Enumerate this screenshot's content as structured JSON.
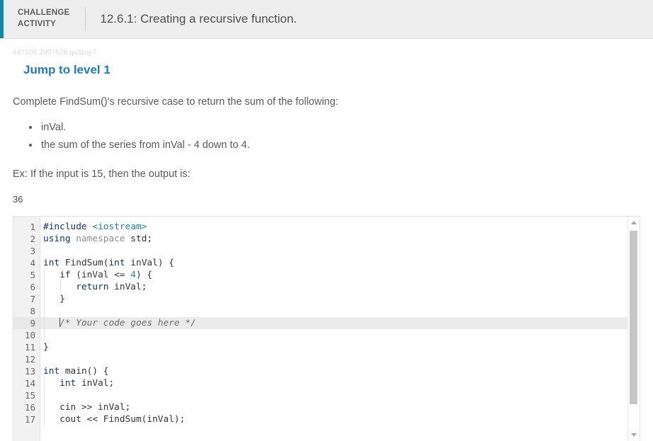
{
  "header": {
    "kicker": "CHALLENGE\nACTIVITY",
    "title": "12.6.1: Creating a recursive function.",
    "accent_color": "#1a84ab"
  },
  "activity": {
    "id": "447108.2097828.qx3zqy7",
    "level_heading": "Jump to level 1",
    "prompt": "Complete FindSum()'s recursive case to return the sum of the following:",
    "bullets": [
      "inVal.",
      "the sum of the series from inVal - 4 down to 4."
    ],
    "example_label": "Ex: If the input is 15, then the output is:",
    "example_output": "36"
  },
  "editor": {
    "active_line": 9,
    "line_numbers": [
      1,
      2,
      3,
      4,
      5,
      6,
      7,
      8,
      9,
      10,
      11,
      12,
      13,
      14,
      15,
      16,
      17
    ],
    "lines": [
      {
        "n": 1,
        "tokens": [
          {
            "t": "pre",
            "v": "#include"
          },
          {
            "t": "plain",
            "v": " "
          },
          {
            "t": "str",
            "v": "<iostream>"
          }
        ]
      },
      {
        "n": 2,
        "tokens": [
          {
            "t": "key",
            "v": "using"
          },
          {
            "t": "plain",
            "v": " "
          },
          {
            "t": "dim",
            "v": "namespace"
          },
          {
            "t": "plain",
            "v": " std;"
          }
        ]
      },
      {
        "n": 3,
        "tokens": []
      },
      {
        "n": 4,
        "tokens": [
          {
            "t": "key",
            "v": "int"
          },
          {
            "t": "plain",
            "v": " FindSum("
          },
          {
            "t": "key",
            "v": "int"
          },
          {
            "t": "plain",
            "v": " inVal) {"
          }
        ]
      },
      {
        "n": 5,
        "tokens": [
          {
            "t": "plain",
            "v": "   "
          },
          {
            "t": "key",
            "v": "if"
          },
          {
            "t": "plain",
            "v": " (inVal <= "
          },
          {
            "t": "num",
            "v": "4"
          },
          {
            "t": "plain",
            "v": ") {"
          }
        ]
      },
      {
        "n": 6,
        "tokens": [
          {
            "t": "plain",
            "v": "      "
          },
          {
            "t": "key",
            "v": "return"
          },
          {
            "t": "plain",
            "v": " inVal;"
          }
        ]
      },
      {
        "n": 7,
        "tokens": [
          {
            "t": "plain",
            "v": "   }"
          }
        ]
      },
      {
        "n": 8,
        "tokens": []
      },
      {
        "n": 9,
        "tokens": [
          {
            "t": "plain",
            "v": "   "
          },
          {
            "t": "caret",
            "v": ""
          },
          {
            "t": "com",
            "v": "/* Your code goes here */"
          }
        ]
      },
      {
        "n": 10,
        "tokens": []
      },
      {
        "n": 11,
        "tokens": [
          {
            "t": "plain",
            "v": "}"
          }
        ]
      },
      {
        "n": 12,
        "tokens": []
      },
      {
        "n": 13,
        "tokens": [
          {
            "t": "key",
            "v": "int"
          },
          {
            "t": "plain",
            "v": " main() {"
          }
        ]
      },
      {
        "n": 14,
        "tokens": [
          {
            "t": "plain",
            "v": "   "
          },
          {
            "t": "key",
            "v": "int"
          },
          {
            "t": "plain",
            "v": " inVal;"
          }
        ]
      },
      {
        "n": 15,
        "tokens": []
      },
      {
        "n": 16,
        "tokens": [
          {
            "t": "plain",
            "v": "   cin >> inVal;"
          }
        ]
      },
      {
        "n": 17,
        "tokens": [
          {
            "t": "plain",
            "v": "   cout << FindSum(inVal);"
          }
        ]
      }
    ],
    "scrollbar": {
      "up_icon": "triangle-up-icon",
      "down_icon": "triangle-down-icon"
    }
  }
}
